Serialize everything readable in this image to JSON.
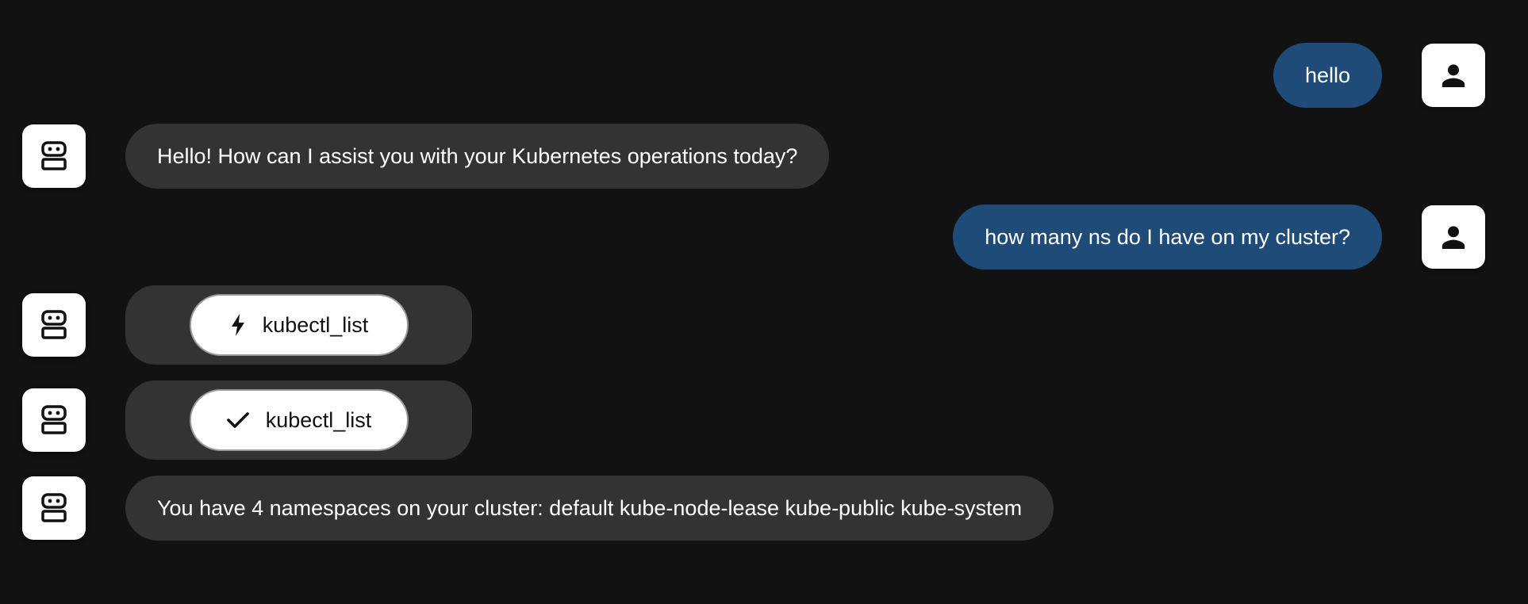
{
  "messages": [
    {
      "role": "user",
      "text": "hello",
      "avatar_icon": "person-icon"
    },
    {
      "role": "assistant",
      "text": "Hello! How can I assist you with your Kubernetes operations today?",
      "avatar_icon": "robot-icon"
    },
    {
      "role": "user",
      "text": "how many ns do I have on my cluster?",
      "avatar_icon": "person-icon"
    },
    {
      "role": "tool_call",
      "tool_name": "kubectl_list",
      "status_icon": "lightning-icon",
      "avatar_icon": "robot-icon"
    },
    {
      "role": "tool_result",
      "tool_name": "kubectl_list",
      "status_icon": "checkmark-icon",
      "avatar_icon": "robot-icon"
    },
    {
      "role": "assistant",
      "text": "You have 4 namespaces on your cluster: default kube-node-lease kube-public kube-system",
      "avatar_icon": "robot-icon"
    }
  ],
  "colors": {
    "background": "#121212",
    "user_bubble": "#1f4b78",
    "assistant_bubble": "#333333",
    "tool_chip": "#ffffff"
  }
}
